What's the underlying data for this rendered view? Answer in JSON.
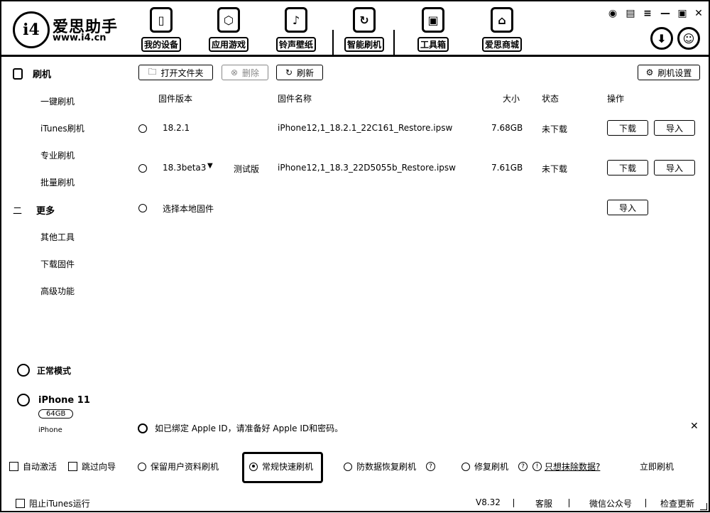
{
  "brand": {
    "logo_text": "i4",
    "name": "爱思助手",
    "url": "www.i4.cn"
  },
  "nav": [
    {
      "label": "我的设备",
      "icon": "phone-icon"
    },
    {
      "label": "应用游戏",
      "icon": "cube-icon"
    },
    {
      "label": "铃声壁纸",
      "icon": "music-icon"
    },
    {
      "label": "智能刷机",
      "icon": "refresh-icon"
    },
    {
      "label": "工具箱",
      "icon": "toolbox-icon"
    },
    {
      "label": "爱思商城",
      "icon": "shopping-bag-icon"
    }
  ],
  "window_icons": [
    "shirt-icon",
    "tablet-icon",
    "menu-icon",
    "minimize-icon",
    "maximize-icon",
    "close-icon"
  ],
  "sidebar": {
    "section1": "刷机",
    "items1": [
      "一键刷机",
      "iTunes刷机",
      "专业刷机",
      "批量刷机"
    ],
    "section2": "更多",
    "items2": [
      "其他工具",
      "下载固件",
      "高级功能"
    ],
    "mode": "正常模式",
    "device_name": "iPhone 11",
    "device_capacity": "64GB",
    "device_type": "iPhone"
  },
  "toolbar": {
    "open_folder": "打开文件夹",
    "delete": "删除",
    "refresh": "刷新",
    "settings": "刷机设置"
  },
  "table": {
    "headers": {
      "version": "固件版本",
      "name": "固件名称",
      "size": "大小",
      "status": "状态",
      "action": "操作"
    },
    "rows": [
      {
        "version": "18.2.1",
        "tag": "",
        "name": "iPhone12,1_18.2.1_22C161_Restore.ipsw",
        "size": "7.68GB",
        "status": "未下载",
        "download": "下载",
        "import": "导入"
      },
      {
        "version": "18.3beta3",
        "tag": "测试版",
        "name": "iPhone12,1_18.3_22D5055b_Restore.ipsw",
        "size": "7.61GB",
        "status": "未下载",
        "download": "下载",
        "import": "导入"
      }
    ],
    "local_label": "选择本地固件",
    "local_import": "导入"
  },
  "notice": "如已绑定 Apple ID，请准备好 Apple ID和密码。",
  "options": {
    "auto_activate": "自动激活",
    "skip_guide": "跳过向导",
    "keep_data": "保留用户资料刷机",
    "quick_flash": "常规快速刷机",
    "anti_recovery": "防数据恢复刷机",
    "repair": "修复刷机",
    "erase_link": "只想抹除数据?",
    "flash_now": "立即刷机"
  },
  "statusbar": {
    "block_itunes": "阻止iTunes运行",
    "version": "V8.32",
    "service": "客服",
    "wechat": "微信公众号",
    "update": "检查更新"
  }
}
